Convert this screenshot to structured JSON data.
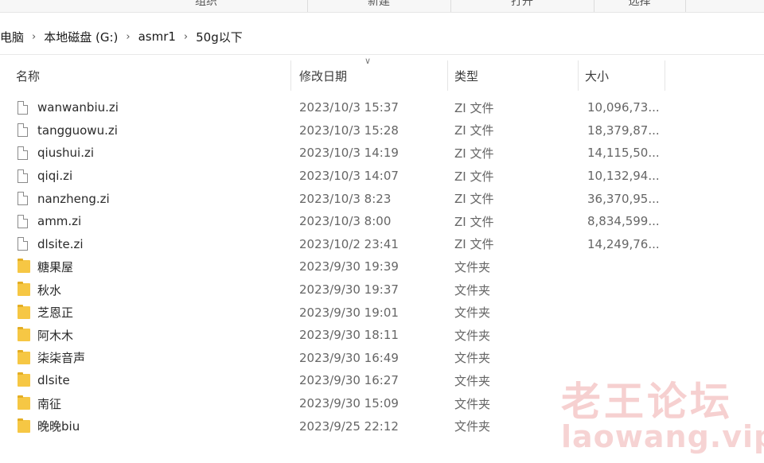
{
  "ribbon": {
    "groups": [
      "组织",
      "新建",
      "打开",
      "选择"
    ]
  },
  "address": {
    "crumbs": [
      "电脑",
      "本地磁盘 (G:)",
      "asmr1",
      "50g以下"
    ]
  },
  "columns": {
    "name": "名称",
    "date": "修改日期",
    "type": "类型",
    "size": "大小"
  },
  "rows": [
    {
      "kind": "file",
      "name": "wanwanbiu.zi",
      "date": "2023/10/3 15:37",
      "type": "ZI 文件",
      "size": "10,096,73..."
    },
    {
      "kind": "file",
      "name": "tangguowu.zi",
      "date": "2023/10/3 15:28",
      "type": "ZI 文件",
      "size": "18,379,87..."
    },
    {
      "kind": "file",
      "name": "qiushui.zi",
      "date": "2023/10/3 14:19",
      "type": "ZI 文件",
      "size": "14,115,50..."
    },
    {
      "kind": "file",
      "name": "qiqi.zi",
      "date": "2023/10/3 14:07",
      "type": "ZI 文件",
      "size": "10,132,94..."
    },
    {
      "kind": "file",
      "name": "nanzheng.zi",
      "date": "2023/10/3 8:23",
      "type": "ZI 文件",
      "size": "36,370,95..."
    },
    {
      "kind": "file",
      "name": "amm.zi",
      "date": "2023/10/3 8:00",
      "type": "ZI 文件",
      "size": "8,834,599..."
    },
    {
      "kind": "file",
      "name": "dlsite.zi",
      "date": "2023/10/2 23:41",
      "type": "ZI 文件",
      "size": "14,249,76..."
    },
    {
      "kind": "folder",
      "name": "糖果屋",
      "date": "2023/9/30 19:39",
      "type": "文件夹",
      "size": ""
    },
    {
      "kind": "folder",
      "name": "秋水",
      "date": "2023/9/30 19:37",
      "type": "文件夹",
      "size": ""
    },
    {
      "kind": "folder",
      "name": "芝恩正",
      "date": "2023/9/30 19:01",
      "type": "文件夹",
      "size": ""
    },
    {
      "kind": "folder",
      "name": "阿木木",
      "date": "2023/9/30 18:11",
      "type": "文件夹",
      "size": ""
    },
    {
      "kind": "folder",
      "name": "柒柒音声",
      "date": "2023/9/30 16:49",
      "type": "文件夹",
      "size": ""
    },
    {
      "kind": "folder",
      "name": "dlsite",
      "date": "2023/9/30 16:27",
      "type": "文件夹",
      "size": ""
    },
    {
      "kind": "folder",
      "name": "南征",
      "date": "2023/9/30 15:09",
      "type": "文件夹",
      "size": ""
    },
    {
      "kind": "folder",
      "name": "晚晚biu",
      "date": "2023/9/25 22:12",
      "type": "文件夹",
      "size": ""
    }
  ],
  "watermark": {
    "title": "老王论坛",
    "url": "laowang.vip"
  },
  "colors": {
    "folder": "#f6c744",
    "watermark": "#e26e6e"
  }
}
